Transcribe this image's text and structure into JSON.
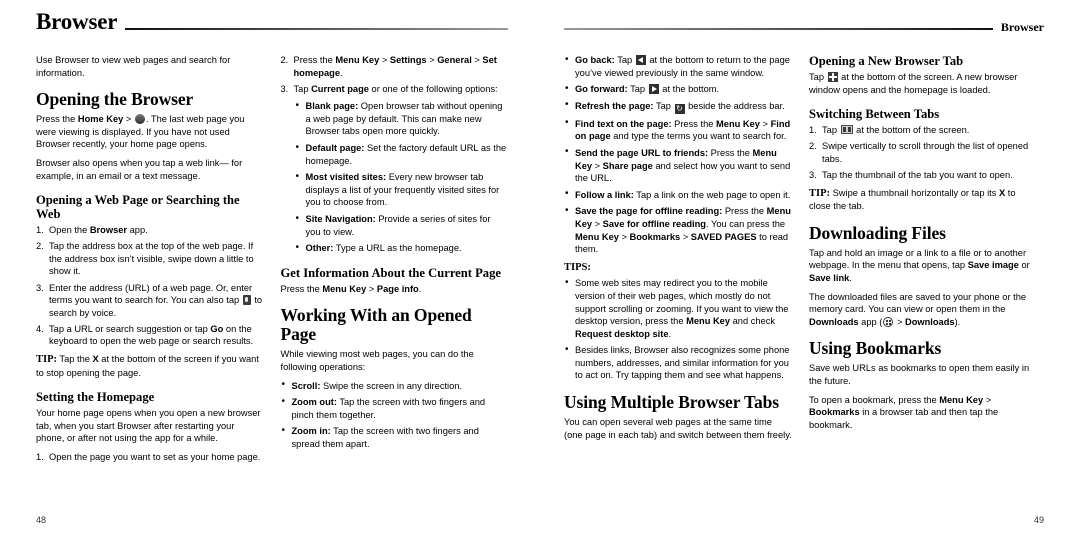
{
  "document": {
    "left_page": {
      "header_title": "Browser",
      "folio": "48"
    },
    "right_page": {
      "header_title": "Browser",
      "folio": "49"
    }
  },
  "col1": {
    "intro": "Use Browser to view web pages and search for information.",
    "h_opening_browser": "Opening the Browser",
    "p_home_key_1": "Press the ",
    "p_home_key_bold": "Home Key",
    "p_home_key_gt": " > ",
    "p_home_key_2": ". The last web page you were viewing is displayed. If you have not used Browser recently, your home page opens.",
    "p_web_link": "Browser also opens when you tap a web link— for example, in an email or a text message.",
    "h_opening_web_page": "Opening a Web Page or Searching the Web",
    "step1_a": "Open the ",
    "step1_b": "Browser",
    "step1_c": " app.",
    "step2": "Tap the address box at the top of the web page. If the address box isn’t visible, swipe down a little to show it.",
    "step3_a": "Enter the address (URL) of a web page. Or, enter terms you want to search for. You can also tap ",
    "step3_b": " to search by voice.",
    "step4_a": "Tap a URL or search suggestion or tap ",
    "step4_b": "Go",
    "step4_c": " on the keyboard to open the web page or search results.",
    "tip_label": "TIP:",
    "tip_a": " Tap the ",
    "tip_b": "X",
    "tip_c": " at the bottom of the screen if you want to stop opening the page.",
    "h_setting_homepage": "Setting the Homepage",
    "p_homepage": "Your home page opens when you open a new browser tab, when you start Browser after restarting your phone, or after not using the app for a while.",
    "step_home_1": "Open the page you want to set as your home page."
  },
  "col2": {
    "step2_a": "Press the ",
    "step2_menu": "Menu Key",
    "step2_gt1": " > ",
    "step2_settings": "Settings",
    "step2_gt2": " > ",
    "step2_general": "General",
    "step2_gt3": " > ",
    "step2_sethome": "Set homepage",
    "step2_end": ".",
    "step3_a": "Tap ",
    "step3_current": "Current page",
    "step3_b": " or one of the following options:",
    "bullets": [
      {
        "label": "Blank page:",
        "text": " Open browser tab without opening a web page by default. This can make new Browser tabs open more quickly."
      },
      {
        "label": "Default page:",
        "text": " Set the factory default URL as the homepage."
      },
      {
        "label": "Most visited sites:",
        "text": " Every new browser tab displays a list of your frequently visited sites for you to choose from."
      },
      {
        "label": "Site Navigation:",
        "text": " Provide a series of sites for you to view."
      },
      {
        "label": "Other:",
        "text": " Type a URL as the homepage."
      }
    ],
    "h_get_info": "Get Information About the Current Page",
    "p_page_info_a": "Press the ",
    "p_page_info_menu": "Menu Key",
    "p_page_info_gt": " > ",
    "p_page_info_bold": "Page info",
    "p_page_info_end": ".",
    "h_working_with": "Working With an Opened Page",
    "p_while_viewing": "While viewing most web pages, you can do the following operations:",
    "bullets2": [
      {
        "label": "Scroll:",
        "text": " Swipe the screen in any direction."
      },
      {
        "label": "Zoom out:",
        "text": " Tap the screen with two fingers and pinch them together."
      },
      {
        "label": "Zoom in:",
        "text": " Tap the screen with two fingers and spread them apart."
      }
    ]
  },
  "col3": {
    "b_goback_label": "Go back:",
    "b_goback_a": " Tap ",
    "b_goback_b": " at the bottom to return to the page you’ve viewed previously in the same window.",
    "b_gofwd_label": "Go forward:",
    "b_gofwd_a": " Tap ",
    "b_gofwd_b": " at the bottom.",
    "b_refresh_label": "Refresh the page:",
    "b_refresh_a": " Tap ",
    "b_refresh_b": " beside the address bar.",
    "b_find_label": "Find text on the page:",
    "b_find_a": " Press the ",
    "b_find_menu": "Menu Key",
    "b_find_gt": " > ",
    "b_find_bold": "Find on page",
    "b_find_end": " and type the terms you want to search for.",
    "b_send_label": "Send the page URL to friends:",
    "b_send_a": " Press the ",
    "b_send_menu": "Menu Key",
    "b_send_gt": " > ",
    "b_send_bold": "Share page",
    "b_send_end": " and select how you want to send the URL.",
    "b_follow_label": "Follow a link:",
    "b_follow_text": " Tap a link on the web page to open it.",
    "b_save_label": "Save the page for offline reading:",
    "b_save_a": " Press the ",
    "b_save_menu": "Menu Key",
    "b_save_gt1": " > ",
    "b_save_bold1": "Save for offline reading",
    "b_save_mid": ". You can press the ",
    "b_save_menu2": "Menu Key",
    "b_save_gt2": " > ",
    "b_save_bold2": "Bookmarks",
    "b_save_gt3": " > ",
    "b_save_bold3": "SAVED PAGES",
    "b_save_end": " to read them.",
    "tips_label": "TIPS:",
    "tip1_a": "Some web sites may redirect you to the mobile version of their web pages, which mostly do not support scrolling or zooming. If you want to view the desktop version, press the ",
    "tip1_menu": "Menu Key",
    "tip1_b": " and check ",
    "tip1_bold": "Request desktop site",
    "tip1_end": ".",
    "tip2": "Besides links, Browser also recognizes some phone numbers, addresses, and similar information for you to act on. Try tapping them and see what happens.",
    "h_multiple_tabs": "Using Multiple Browser Tabs",
    "p_multiple_tabs": "You can open several web pages at the same time (one page in each tab) and switch between them freely."
  },
  "col4": {
    "h_new_tab": "Opening a New Browser Tab",
    "p_new_tab_a": "Tap ",
    "p_new_tab_b": " at the bottom of the screen. A new browser window opens and the homepage is loaded.",
    "h_switching": "Switching Between Tabs",
    "sw_step1_a": "Tap ",
    "sw_step1_b": " at the bottom of the screen.",
    "sw_step2": "Swipe vertically to scroll through the list of opened tabs.",
    "sw_step3": "Tap the thumbnail of the tab you want to open.",
    "tip_label": "TIP:",
    "tip_a": " Swipe a thumbnail horizontally or tap its ",
    "tip_x": "X",
    "tip_b": " to close the tab.",
    "h_downloading": "Downloading Files",
    "p_download_a": "Tap and hold an image or a link to a file or to another webpage. In the menu that opens, tap ",
    "p_download_b": "Save image",
    "p_download_c": " or ",
    "p_download_d": "Save link",
    "p_download_e": ".",
    "p_download2_a": "The downloaded files are saved to your phone or the memory card. You can view or open them in the ",
    "p_download2_b": "Downloads",
    "p_download2_c": " app (",
    "p_download2_d": " > ",
    "p_download2_e": "Downloads",
    "p_download2_f": ").",
    "h_bookmarks": "Using Bookmarks",
    "p_bookmarks1": "Save web URLs as bookmarks to open them easily in the future.",
    "p_bookmarks2_a": "To open a bookmark, press the ",
    "p_bookmarks2_menu": "Menu Key",
    "p_bookmarks2_gt": " > ",
    "p_bookmarks2_bold": "Bookmarks",
    "p_bookmarks2_end": " in a browser tab and then tap the bookmark."
  },
  "icons": {
    "home": "home-circle-icon",
    "mic": "microphone-icon",
    "back": "back-arrow-icon",
    "forward": "forward-arrow-icon",
    "refresh": "refresh-icon",
    "plus": "plus-icon",
    "tabs": "tabs-icon",
    "apps": "apps-grid-icon"
  }
}
